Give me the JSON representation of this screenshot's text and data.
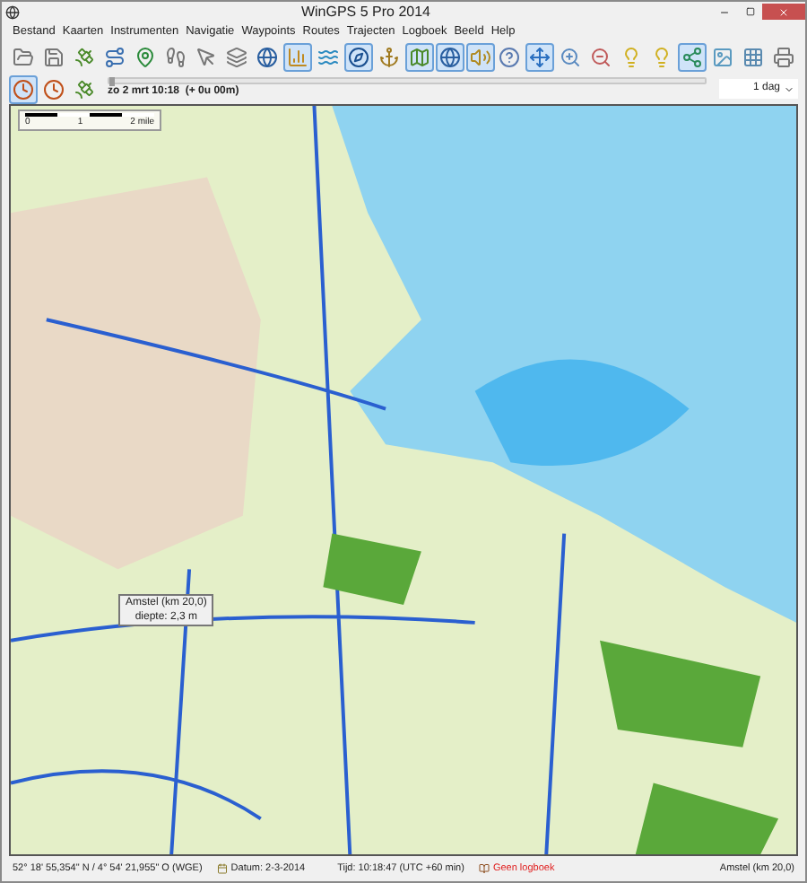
{
  "window": {
    "title": "WinGPS 5 Pro 2014"
  },
  "menu": [
    "Bestand",
    "Kaarten",
    "Instrumenten",
    "Navigatie",
    "Waypoints",
    "Routes",
    "Trajecten",
    "Logboek",
    "Beeld",
    "Help"
  ],
  "toolbar": [
    {
      "kind": "open",
      "selected": false
    },
    {
      "kind": "save",
      "selected": false
    },
    {
      "kind": "gps",
      "selected": false
    },
    {
      "kind": "route",
      "selected": false
    },
    {
      "kind": "waypoint",
      "selected": false
    },
    {
      "kind": "track",
      "selected": false
    },
    {
      "kind": "mouse",
      "selected": false
    },
    {
      "kind": "layers",
      "selected": false
    },
    {
      "kind": "globe",
      "selected": false
    },
    {
      "kind": "chart",
      "selected": true
    },
    {
      "kind": "tide",
      "selected": false
    },
    {
      "kind": "compass",
      "selected": true
    },
    {
      "kind": "anchor",
      "selected": false
    },
    {
      "kind": "map",
      "selected": true
    },
    {
      "kind": "globe",
      "selected": true
    },
    {
      "kind": "sound",
      "selected": true
    },
    {
      "kind": "help",
      "selected": false
    },
    {
      "kind": "move",
      "selected": true
    },
    {
      "kind": "zoomin",
      "selected": false
    },
    {
      "kind": "zoomout",
      "selected": false
    },
    {
      "kind": "bulb",
      "selected": false
    },
    {
      "kind": "bulb",
      "selected": false
    },
    {
      "kind": "share",
      "selected": true
    },
    {
      "kind": "image",
      "selected": false
    },
    {
      "kind": "grid",
      "selected": false
    },
    {
      "kind": "print",
      "selected": false
    }
  ],
  "time_toolbar": [
    {
      "kind": "clock",
      "selected": true
    },
    {
      "kind": "clock",
      "selected": false
    },
    {
      "kind": "gps",
      "selected": false
    }
  ],
  "timeline": {
    "label": "zo 2 mrt 10:18  (+ 0u 00m)",
    "level": 0
  },
  "period": {
    "value": "1 dag"
  },
  "map": {
    "scale": [
      "0",
      "1",
      "2 mile"
    ],
    "tooltip": [
      "Amstel (km 20,0)",
      "diepte: 2,3 m"
    ]
  },
  "status_bar": {
    "position": "52° 18' 55,354\" N / 4° 54' 21,955\" O (WGE)",
    "date": "Datum: 2-3-2014",
    "time": "Tijd: 10:18:47 (UTC +60 min)",
    "logbook": "Geen logboek",
    "location": "Amstel (km 20,0)"
  }
}
